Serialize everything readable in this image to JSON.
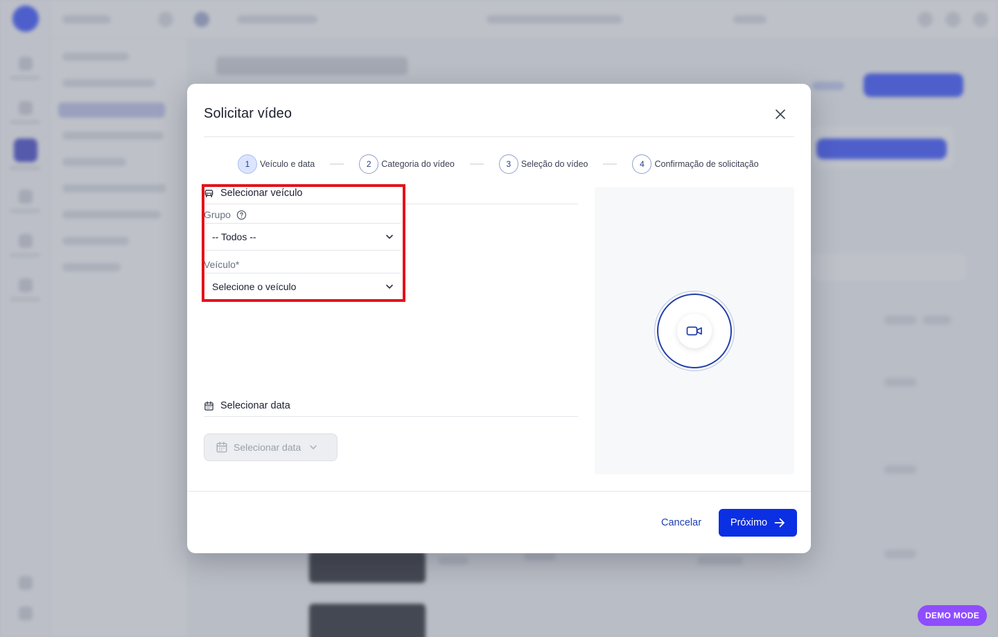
{
  "modal": {
    "title": "Solicitar vídeo",
    "steps": [
      {
        "num": "1",
        "label": "Veículo e data"
      },
      {
        "num": "2",
        "label": "Categoria do vídeo"
      },
      {
        "num": "3",
        "label": "Seleção do vídeo"
      },
      {
        "num": "4",
        "label": "Confirmação de solicitação"
      }
    ],
    "vehicle_section": {
      "heading": "Selecionar veículo",
      "group_label": "Grupo",
      "group_value": "-- Todos --",
      "vehicle_label": "Veículo*",
      "vehicle_value": "Selecione o veículo"
    },
    "date_section": {
      "heading": "Selecionar data",
      "button_label": "Selecionar data"
    },
    "footer": {
      "cancel_label": "Cancelar",
      "next_label": "Próximo"
    }
  },
  "badge": "DEMO MODE",
  "colors": {
    "primary": "#0b2fe3",
    "highlight": "#e4121a",
    "badge": "#8e4dff"
  }
}
